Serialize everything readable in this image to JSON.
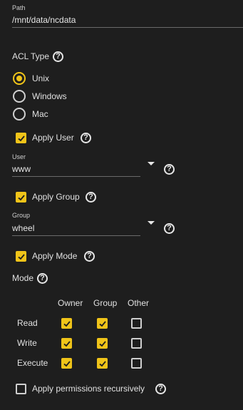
{
  "path": {
    "label": "Path",
    "value": "/mnt/data/ncdata"
  },
  "acl": {
    "label": "ACL Type",
    "options": [
      {
        "label": "Unix",
        "selected": true
      },
      {
        "label": "Windows",
        "selected": false
      },
      {
        "label": "Mac",
        "selected": false
      }
    ]
  },
  "apply_user": {
    "label": "Apply User",
    "checked": true
  },
  "user": {
    "label": "User",
    "value": "www"
  },
  "apply_group": {
    "label": "Apply Group",
    "checked": true
  },
  "group": {
    "label": "Group",
    "value": "wheel"
  },
  "apply_mode": {
    "label": "Apply Mode",
    "checked": true
  },
  "mode": {
    "label": "Mode",
    "columns": [
      "Owner",
      "Group",
      "Other"
    ],
    "rows": [
      {
        "label": "Read",
        "values": [
          true,
          true,
          false
        ]
      },
      {
        "label": "Write",
        "values": [
          true,
          true,
          false
        ]
      },
      {
        "label": "Execute",
        "values": [
          true,
          true,
          false
        ]
      }
    ]
  },
  "recursive": {
    "label": "Apply permissions recursively",
    "checked": false
  },
  "icons": {
    "help": "help-circle-icon",
    "dropdown": "caret-down-icon",
    "check": "check-icon"
  },
  "colors": {
    "accent": "#f0c419",
    "background": "#1e1e1e"
  }
}
